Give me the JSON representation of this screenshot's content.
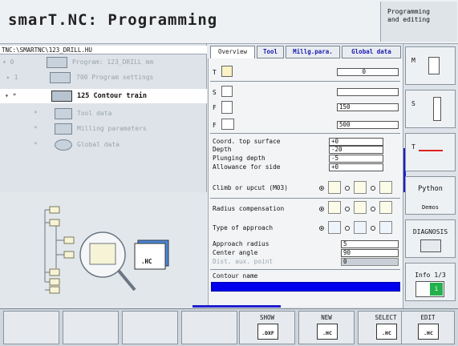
{
  "app_title": "smarT.NC: Programming",
  "mode": {
    "line1": "Programming",
    "line2": "and editing"
  },
  "path": "TNC:\\SMARTNC\\123_DRILL.HU",
  "tree": [
    {
      "prefix": "▾ 0",
      "label": "Program: 123_DRILL mm"
    },
    {
      "prefix": "▸ 1",
      "label": "700 Program settings"
    },
    {
      "prefix": "▾ *",
      "label": "125 Contour train"
    },
    {
      "prefix": "*",
      "label": "Tool data"
    },
    {
      "prefix": "*",
      "label": "Milling parameters"
    },
    {
      "prefix": "*",
      "label": "Global data"
    }
  ],
  "preview_icon_label": ".HC",
  "tabs": [
    "Overview",
    "Tool",
    "Millg.para.",
    "Global data"
  ],
  "form": {
    "t_label": "T",
    "t_value": "0",
    "s_label": "S",
    "s_value": "",
    "f_label": "F",
    "f_value": "150",
    "f2_label": "F",
    "f2_value": "500",
    "coord_top": {
      "label": "Coord. top surface",
      "value": "+0"
    },
    "depth": {
      "label": "Depth",
      "value": "-20"
    },
    "plunging": {
      "label": "Plunging depth",
      "value": "-5"
    },
    "allowance": {
      "label": "Allowance for side",
      "value": "+0"
    },
    "climb": {
      "label": "Climb or upcut (M03)"
    },
    "radius_comp": {
      "label": "Radius compensation"
    },
    "approach_type": {
      "label": "Type of approach"
    },
    "approach_radius": {
      "label": "Approach radius",
      "value": "5"
    },
    "center_angle": {
      "label": "Center angle",
      "value": "90"
    },
    "dist_aux": {
      "label": "Dist. aux. point",
      "value": "0"
    },
    "contour_name": {
      "label": "Contour name",
      "value": ""
    }
  },
  "right_keys": {
    "m": "M",
    "s": "S",
    "t": "T",
    "python": "Python",
    "demos": "Demos",
    "diag": "DIAGNOSIS",
    "info": "Info 1/3",
    "info_i": "i"
  },
  "bottom_keys": [
    {
      "top": "SHOW",
      "sub": ".DXF"
    },
    {
      "top": "NEW",
      "sub": ".HC"
    },
    {
      "top": "SELECT",
      "sub": ".HC"
    },
    {
      "top": "EDIT",
      "sub": ".HC"
    }
  ],
  "colors": {
    "accent": "#1e1ecc",
    "selection": "#0000ee"
  }
}
